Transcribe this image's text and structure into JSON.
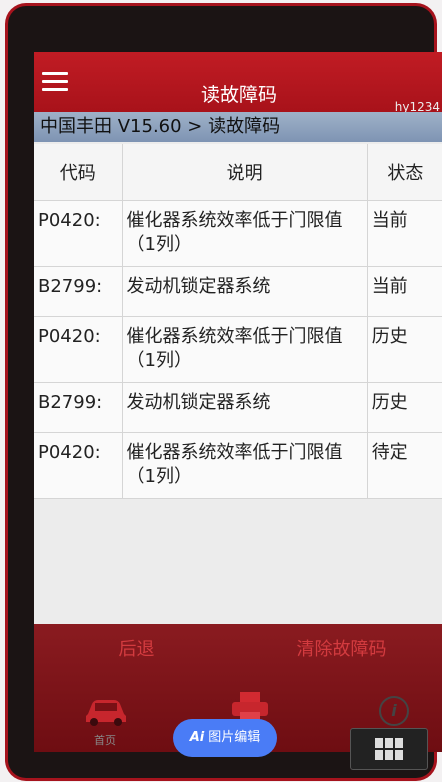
{
  "header": {
    "title": "读故障码",
    "user": "hy1234",
    "breadcrumb": "中国丰田 V15.60 > 读故障码"
  },
  "table": {
    "columns": {
      "code": "代码",
      "description": "说明",
      "status": "状态"
    },
    "rows": [
      {
        "code": "P0420:",
        "description": "催化器系统效率低于门限值（1列）",
        "status": "当前"
      },
      {
        "code": "B2799:",
        "description": "发动机锁定器系统",
        "status": "当前"
      },
      {
        "code": "P0420:",
        "description": "催化器系统效率低于门限值（1列）",
        "status": "历史"
      },
      {
        "code": "B2799:",
        "description": "发动机锁定器系统",
        "status": "历史"
      },
      {
        "code": "P0420:",
        "description": "催化器系统效率低于门限值（1列）",
        "status": "待定"
      }
    ]
  },
  "footer": {
    "back_label": "后退",
    "clear_label": "清除故障码",
    "home_label": "首页",
    "print_label": "打印"
  },
  "overlay": {
    "ai_label": "图片编辑",
    "ai_prefix": "Ai"
  },
  "colors": {
    "header_red": "#b3161e",
    "ai_blue": "#4a7cf6"
  }
}
